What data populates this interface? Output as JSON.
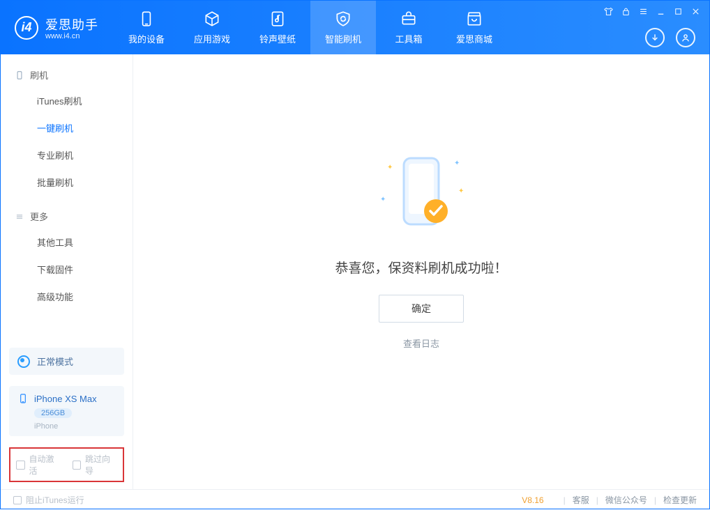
{
  "app": {
    "name_cn": "爱思助手",
    "name_en": "www.i4.cn"
  },
  "topnav": {
    "items": [
      {
        "label": "我的设备"
      },
      {
        "label": "应用游戏"
      },
      {
        "label": "铃声壁纸"
      },
      {
        "label": "智能刷机"
      },
      {
        "label": "工具箱"
      },
      {
        "label": "爱思商城"
      }
    ],
    "selected_index": 3
  },
  "sidebar": {
    "groups": [
      {
        "header": "刷机",
        "items": [
          {
            "label": "iTunes刷机"
          },
          {
            "label": "一键刷机",
            "selected": true
          },
          {
            "label": "专业刷机"
          },
          {
            "label": "批量刷机"
          }
        ]
      },
      {
        "header": "更多",
        "items": [
          {
            "label": "其他工具"
          },
          {
            "label": "下载固件"
          },
          {
            "label": "高级功能"
          }
        ]
      }
    ]
  },
  "mode": {
    "label": "正常模式"
  },
  "device": {
    "name": "iPhone XS Max",
    "storage": "256GB",
    "type": "iPhone"
  },
  "bottom_options": {
    "auto_activate": "自动激活",
    "skip_guide": "跳过向导"
  },
  "main": {
    "success_title": "恭喜您，保资料刷机成功啦！",
    "ok_button": "确定",
    "view_log": "查看日志"
  },
  "footer": {
    "block_itunes": "阻止iTunes运行",
    "version": "V8.16",
    "support": "客服",
    "wechat": "微信公众号",
    "check_update": "检查更新"
  }
}
